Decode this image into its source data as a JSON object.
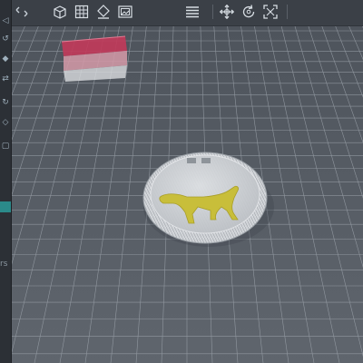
{
  "toolbar": {
    "buttons": [
      {
        "name": "collapse-panel-button",
        "icon": "collapse-arrows-icon"
      },
      {
        "name": "view-cube-button",
        "icon": "view-cube-icon"
      },
      {
        "name": "grid-toggle-button",
        "icon": "grid-icon"
      },
      {
        "name": "material-button",
        "icon": "paint-bucket-icon"
      },
      {
        "name": "background-image-button",
        "icon": "image-frame-icon"
      },
      {
        "name": "menu-button",
        "icon": "hamburger-icon"
      },
      {
        "name": "move-tool-button",
        "icon": "move-arrows-icon"
      },
      {
        "name": "rotate-tool-button",
        "icon": "rotate-icon"
      },
      {
        "name": "scale-tool-button",
        "icon": "scale-icon"
      }
    ]
  },
  "left_strip": {
    "partial_label": "rs"
  },
  "scene": {
    "objects": [
      {
        "name": "coin-model",
        "description": "round coin with knurled rim",
        "color": "#c9ccd0"
      },
      {
        "name": "dog-relief",
        "color": "#c8be3a"
      },
      {
        "name": "stacked-block-model",
        "colors": [
          "#c23a5a",
          "#d8a9b4"
        ]
      }
    ]
  },
  "colors": {
    "toolbar_bg": "#3b4047",
    "grid_bg": "#5a6068",
    "grid_line": "#9aa2aa",
    "accent": "#2b8a8a"
  }
}
